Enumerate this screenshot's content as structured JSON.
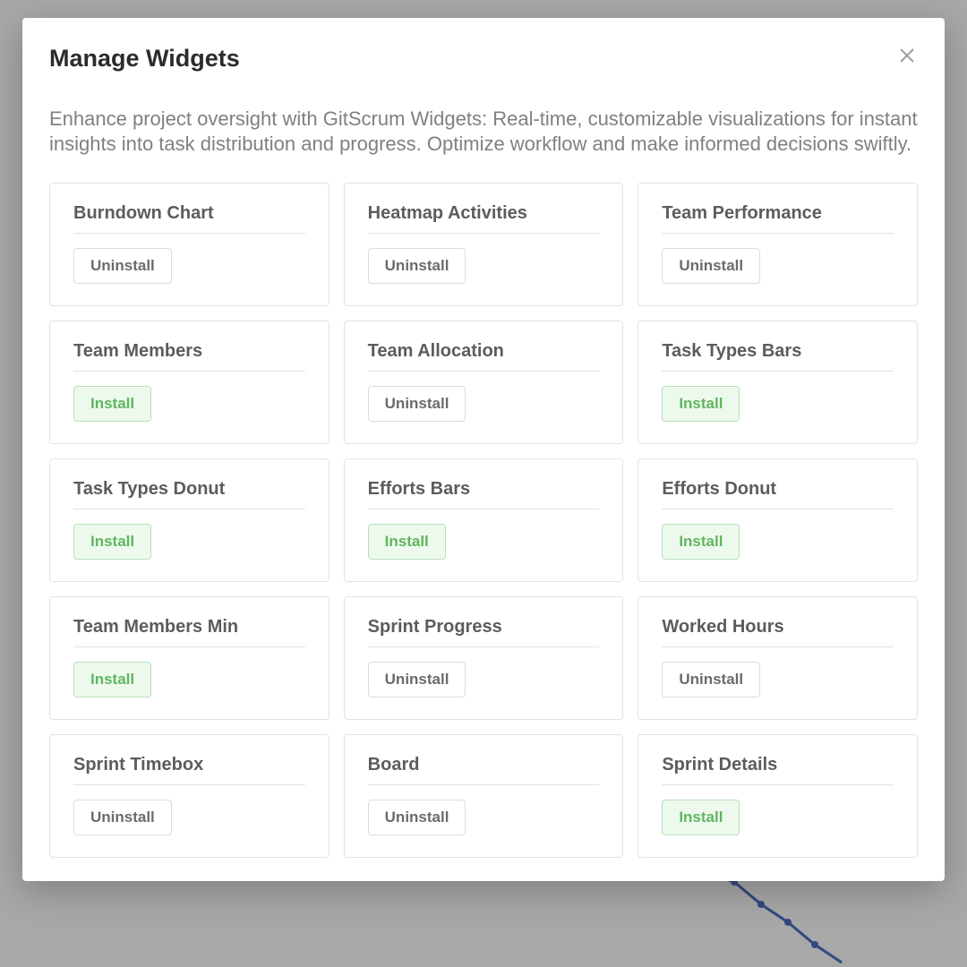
{
  "modal": {
    "title": "Manage Widgets",
    "description": "Enhance project oversight with GitScrum Widgets: Real-time, customizable visualizations for instant insights into task distribution and progress. Optimize workflow and make informed decisions swiftly."
  },
  "labels": {
    "install": "Install",
    "uninstall": "Uninstall"
  },
  "widgets": [
    {
      "name": "Burndown Chart",
      "installed": true
    },
    {
      "name": "Heatmap Activities",
      "installed": true
    },
    {
      "name": "Team Performance",
      "installed": true
    },
    {
      "name": "Team Members",
      "installed": false
    },
    {
      "name": "Team Allocation",
      "installed": true
    },
    {
      "name": "Task Types Bars",
      "installed": false
    },
    {
      "name": "Task Types Donut",
      "installed": false
    },
    {
      "name": "Efforts Bars",
      "installed": false
    },
    {
      "name": "Efforts Donut",
      "installed": false
    },
    {
      "name": "Team Members Min",
      "installed": false
    },
    {
      "name": "Sprint Progress",
      "installed": true
    },
    {
      "name": "Worked Hours",
      "installed": true
    },
    {
      "name": "Sprint Timebox",
      "installed": true
    },
    {
      "name": "Board",
      "installed": true
    },
    {
      "name": "Sprint Details",
      "installed": false
    }
  ]
}
